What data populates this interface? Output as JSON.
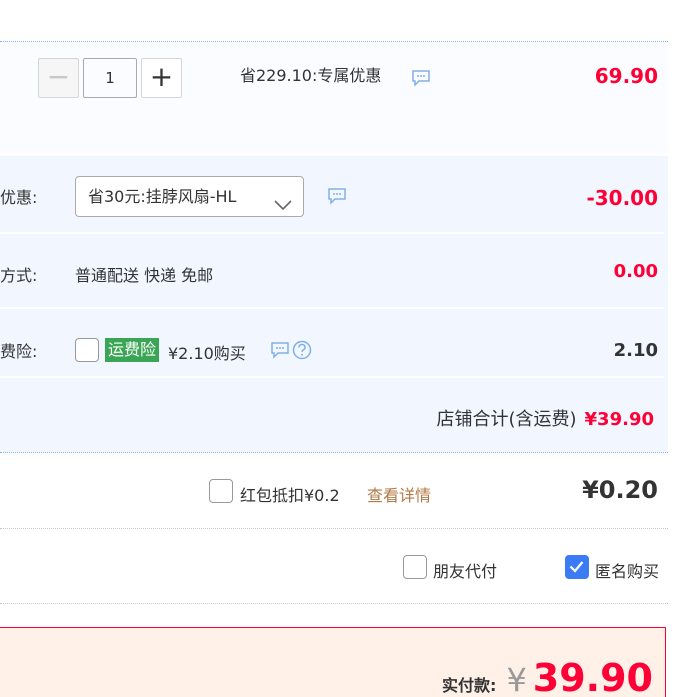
{
  "product": {
    "quantity": "1",
    "minus_label": "−",
    "plus_label": "+",
    "saving_text": "省229.10:专属优惠",
    "price": "69.90"
  },
  "shop_discount": {
    "label": "优惠:",
    "selected": "省30元:挂脖风扇-HL",
    "amount": "-30.00"
  },
  "shipping": {
    "label": "方式:",
    "value": "普通配送 快递 免邮",
    "amount": "0.00"
  },
  "insurance": {
    "label": "费险:",
    "tag": "运费险",
    "price_text": "¥2.10购买",
    "amount": "2.10",
    "checked": false
  },
  "shop_total": {
    "label": "店铺合计(含运费)",
    "amount": "¥39.90"
  },
  "red_packet": {
    "label": "红包抵扣¥0.2",
    "link": "查看详情",
    "amount": "¥0.20"
  },
  "options": {
    "friend_pay": "朋友代付",
    "anonymous": "匿名购买",
    "anonymous_checked": true
  },
  "payment": {
    "label": "实付款:",
    "yen": "¥",
    "amount": "39.90"
  },
  "colors": {
    "accent_red": "#ff0036",
    "link_brown": "#b17a45",
    "tag_green": "#3aa655",
    "checkbox_blue": "#3b7cf5",
    "block_bg": "#f2f7ff"
  }
}
